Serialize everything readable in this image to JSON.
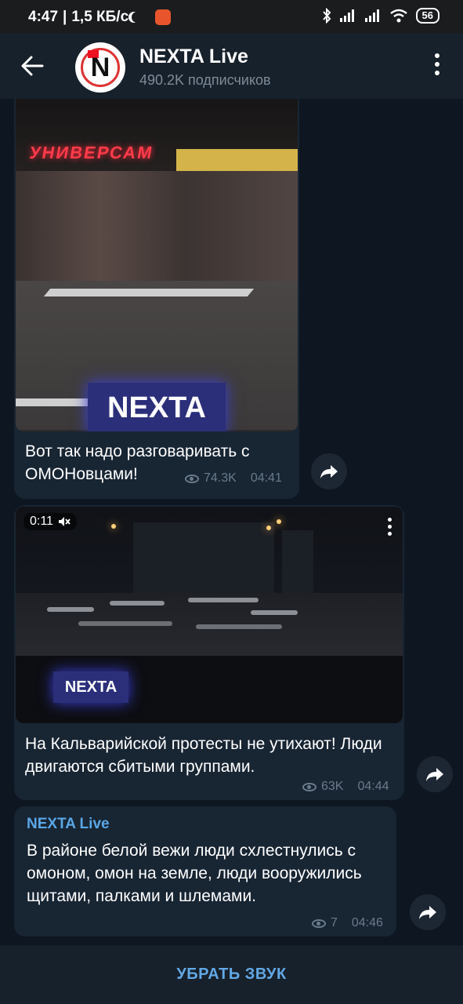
{
  "status_bar": {
    "time": "4:47",
    "speed": "1,5 КБ/с",
    "battery": "56"
  },
  "header": {
    "back_icon": "arrow-left-icon",
    "channel_title": "NEXTA Live",
    "subscribers": "490.2K подписчиков",
    "menu_icon": "more-vertical-icon"
  },
  "messages": [
    {
      "type": "photo",
      "watermark": "NEXTA",
      "photo_sign": "УНИВЕРСАМ",
      "caption": "Вот так надо разговаривать с ОМОНовцами!",
      "views": "74.3K",
      "time": "04:41"
    },
    {
      "type": "video",
      "duration": "0:11",
      "watermark": "NEXTA",
      "caption": "На Кальварийской протесты не утихают! Люди двигаются сбитыми группами.",
      "views": "63K",
      "time": "04:44"
    },
    {
      "type": "text",
      "sender": "NEXTA Live",
      "text": "В районе белой вежи люди схлестнулись с омоном, омон на земле, люди вооружились щитами, палками и шлемами.",
      "views": "7",
      "time": "04:46"
    }
  ],
  "bottom_action": "УБРАТЬ ЗВУК",
  "colors": {
    "background": "#0e1621",
    "header": "#17212b",
    "bubble": "#182533",
    "accent": "#62a8e5"
  }
}
